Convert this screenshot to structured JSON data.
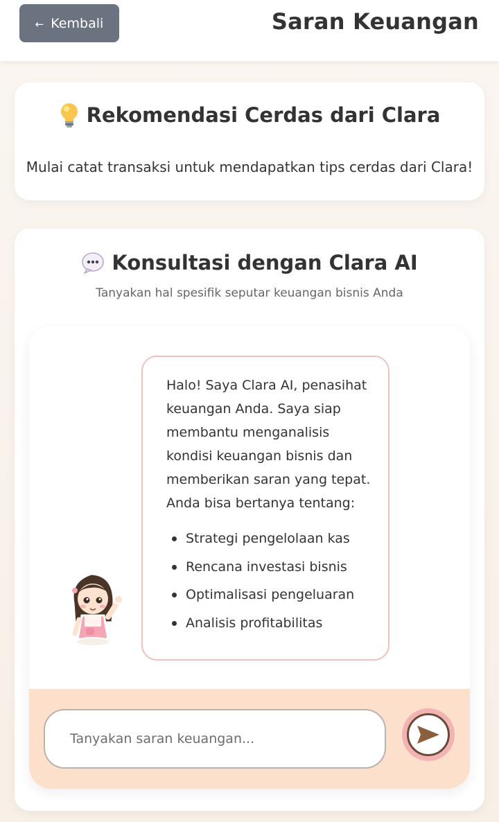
{
  "header": {
    "back_label": "Kembali",
    "back_arrow": "←",
    "title": "Saran Keuangan"
  },
  "recommendation": {
    "icon": "lightbulb-icon",
    "title": "Rekomendasi Cerdas dari Clara",
    "message": "Mulai catat transaksi untuk mendapatkan tips cerdas dari Clara!"
  },
  "consultation": {
    "icon": "speech-bubble-icon",
    "title": "Konsultasi dengan Clara AI",
    "subtitle": "Tanyakan hal spesifik seputar keuangan bisnis Anda",
    "message": {
      "intro": "Halo! Saya Clara AI, penasihat keuangan Anda. Saya siap membantu menganalisis kondisi keuangan bisnis dan memberikan saran yang tepat. Anda bisa bertanya tentang:",
      "topics": [
        "Strategi pengelolaan kas",
        "Rencana investasi bisnis",
        "Optimalisasi pengeluaran",
        "Analisis profitabilitas"
      ]
    },
    "input": {
      "placeholder": "Tanyakan saran keuangan...",
      "value": ""
    },
    "send_icon": "send-arrow-icon"
  },
  "colors": {
    "back_button": "#6b7280",
    "bubble_border": "#f0c2bb",
    "input_bar": "#fde0cb",
    "send_ring": "#f1b3b3",
    "send_arrow": "#8b5e3c"
  }
}
